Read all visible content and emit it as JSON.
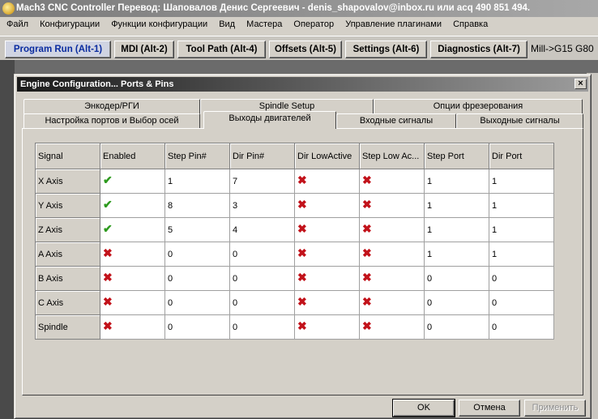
{
  "window": {
    "title": "Mach3 CNC Controller Перевод: Шаповалов Денис Сергеевич - denis_shapovalov@inbox.ru или acq 490 851 494."
  },
  "menu": [
    "Файл",
    "Конфигурации",
    "Функции конфигурации",
    "Вид",
    "Мастера",
    "Оператор",
    "Управление плагинами",
    "Справка"
  ],
  "screen_tabs": [
    "Program Run (Alt-1)",
    "MDI (Alt-2)",
    "Tool Path (Alt-4)",
    "Offsets (Alt-5)",
    "Settings (Alt-6)",
    "Diagnostics (Alt-7)"
  ],
  "gcode_label": "Mill->G15  G80",
  "dialog": {
    "title": "Engine Configuration... Ports & Pins",
    "close": "×",
    "tabs_back": [
      "Энкодер/РГИ",
      "Spindle Setup",
      "Опции фрезерования"
    ],
    "tabs_front": [
      "Настройка портов и Выбор осей",
      "Выходы двигателей",
      "Входные сигналы",
      "Выходные сигналы"
    ],
    "active_tab": "Выходы двигателей",
    "columns": [
      "Signal",
      "Enabled",
      "Step Pin#",
      "Dir Pin#",
      "Dir LowActive",
      "Step Low Ac...",
      "Step Port",
      "Dir Port"
    ],
    "rows": [
      {
        "signal": "X Axis",
        "enabled": true,
        "step_pin": "1",
        "dir_pin": "7",
        "dir_low": false,
        "step_low": false,
        "step_port": "1",
        "dir_port": "1"
      },
      {
        "signal": "Y Axis",
        "enabled": true,
        "step_pin": "8",
        "dir_pin": "3",
        "dir_low": false,
        "step_low": false,
        "step_port": "1",
        "dir_port": "1"
      },
      {
        "signal": "Z Axis",
        "enabled": true,
        "step_pin": "5",
        "dir_pin": "4",
        "dir_low": false,
        "step_low": false,
        "step_port": "1",
        "dir_port": "1"
      },
      {
        "signal": "A Axis",
        "enabled": false,
        "step_pin": "0",
        "dir_pin": "0",
        "dir_low": false,
        "step_low": false,
        "step_port": "1",
        "dir_port": "1"
      },
      {
        "signal": "B Axis",
        "enabled": false,
        "step_pin": "0",
        "dir_pin": "0",
        "dir_low": false,
        "step_low": false,
        "step_port": "0",
        "dir_port": "0"
      },
      {
        "signal": "C Axis",
        "enabled": false,
        "step_pin": "0",
        "dir_pin": "0",
        "dir_low": false,
        "step_low": false,
        "step_port": "0",
        "dir_port": "0"
      },
      {
        "signal": "Spindle",
        "enabled": false,
        "step_pin": "0",
        "dir_pin": "0",
        "dir_low": false,
        "step_low": false,
        "step_port": "0",
        "dir_port": "0"
      }
    ],
    "buttons": {
      "ok": "OK",
      "cancel": "Отмена",
      "apply": "Применить"
    }
  },
  "colors": {
    "check": "#2d9a1e",
    "cross": "#c2121a",
    "active_tab_text": "#0a2ca0"
  },
  "icons": {
    "enabled_true": "green-check-icon",
    "enabled_false": "red-x-icon"
  }
}
